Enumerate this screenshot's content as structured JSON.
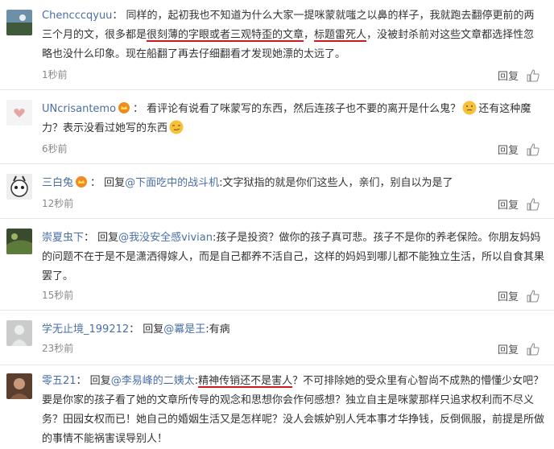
{
  "comments": [
    {
      "user": "Chencccqyuu",
      "text_a": "： 同样的，起初我也不知道为什么大家一提咪蒙就嗤之以鼻的样子，我就跑去翻停更前的两三个月的文，很多都是",
      "text_hl1": "很刻薄的字眼或者三观特歪的文章",
      "text_b": "，",
      "text_hl2": "标题雷死人",
      "text_c": "，没被封杀前对这些文章都选择性忽略也没什么印象。现在船翻了再去仔细翻看才发现她漂的太远了。",
      "time": "1秒前",
      "reply": "回复"
    },
    {
      "user": "UNcrisantemo",
      "text_a": "： 看评论有说看了咪蒙写的东西，然后连孩子也不要的离开是什么鬼？",
      "text_b": "还有这种魔力？表示没看过她写的东西",
      "time": "6秒前",
      "reply": "回复"
    },
    {
      "user": "三白兔",
      "text_a": "： 回复",
      "mention": "@下面吃中的战斗机",
      "text_b": ":文字狱指的就是你们这些人，亲们，别自以为是了",
      "time": "12秒前",
      "reply": "回复"
    },
    {
      "user": "崇夏虫下",
      "text_a": "： 回复",
      "mention": "@我没安全感vivian",
      "text_b": ":孩子是投资？做你的孩子真可悲。孩子不是你的养老保险。你朋友妈妈的问题不在于是不是潇洒得嫁人，而是自己都养不活自己，这样的妈妈到哪儿都不能独立生活，所以自食其果罢了。",
      "time": "15秒前",
      "reply": "回复"
    },
    {
      "user": "学无止境_199212",
      "text_a": "： 回复",
      "mention": "@冪是王",
      "text_b": ":有病",
      "time": "23秒前",
      "reply": "回复"
    },
    {
      "user": "零五21",
      "text_a": "： 回复",
      "mention": "@李易峰的二姨太",
      "text_b": ":",
      "text_hl1": "精神传销还不是害人",
      "text_c": "？不可排除她的受众里有心智尚不成熟的懵懂少女吧？要是你家的孩子看了她的文章所传导的观念和思想你会作何感想？独立自主是咪蒙那样只追求权利而不尽义务？田园女权而已！她自己的婚姻生活又是怎样呢？没人会嫉妒别人凭本事才华挣钱，反倒佩服，前提是所做的事情不能祸害误导别人！",
      "time": "",
      "reply": ""
    }
  ],
  "colors": {
    "link": "#4a6fa5",
    "meta": "#888888",
    "underline": "#cc1a1a"
  }
}
